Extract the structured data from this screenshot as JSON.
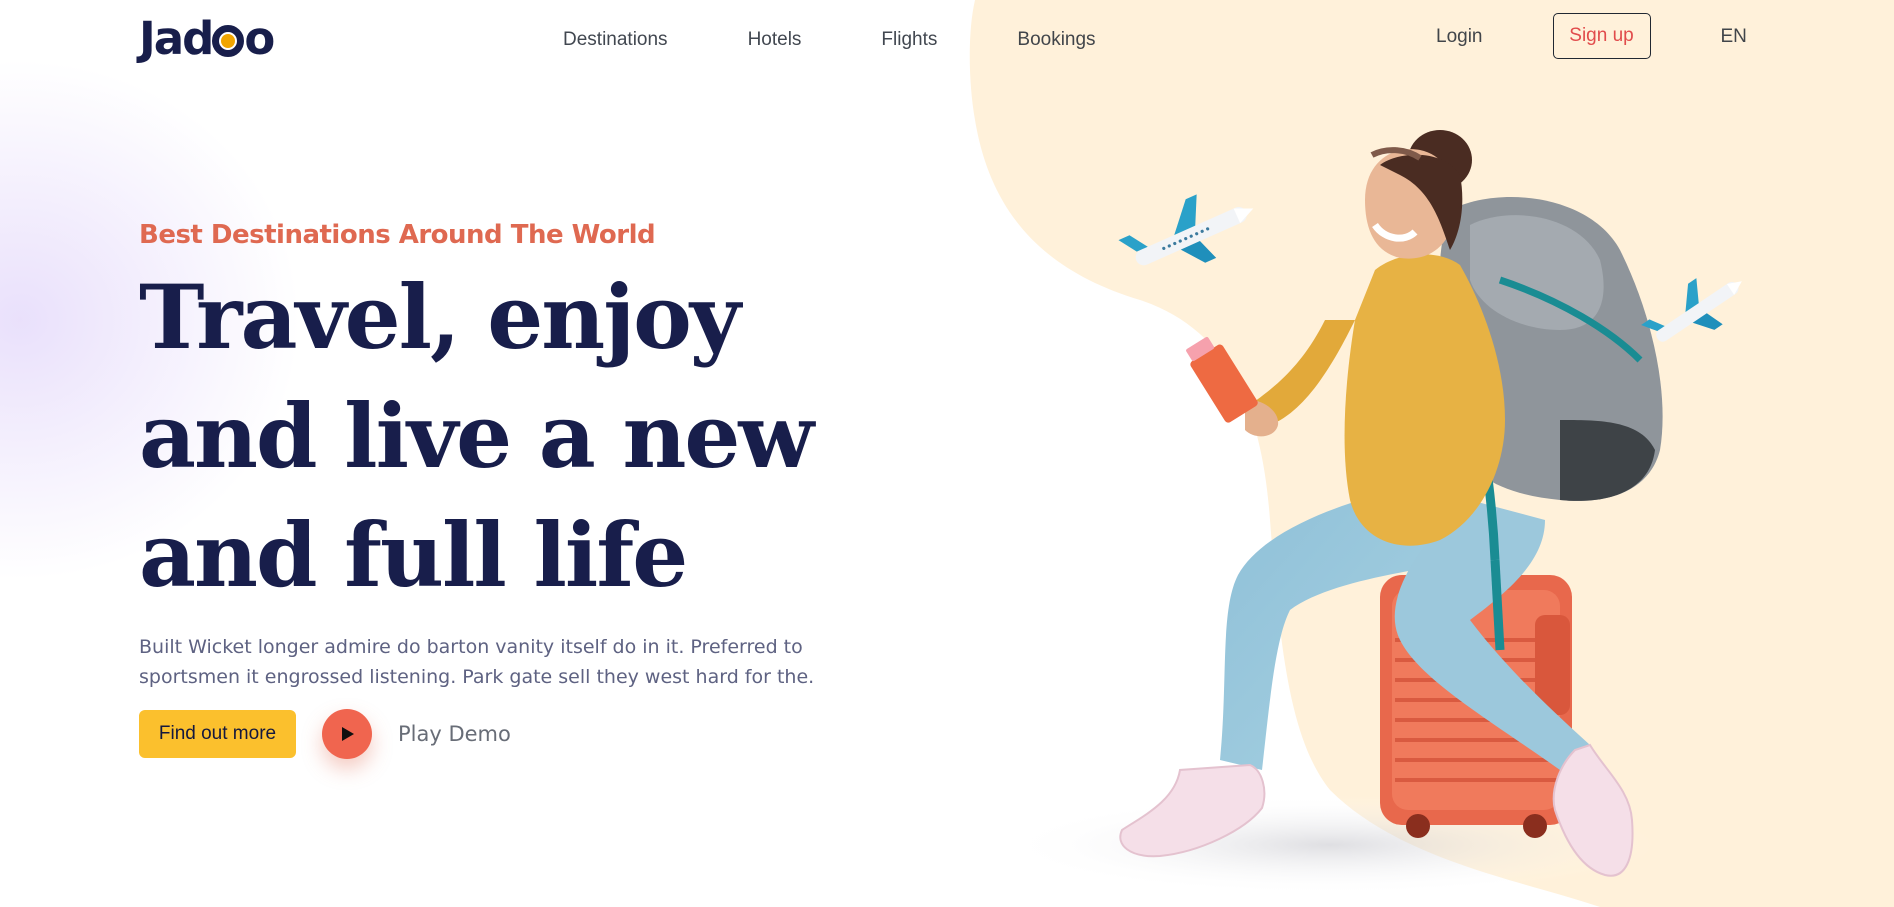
{
  "brand": {
    "logo_text_left": "Jad",
    "logo_text_right": "o",
    "accent_color": "#df6951",
    "yellow_color": "#f1a501"
  },
  "nav": {
    "links": [
      "Destinations",
      "Hotels",
      "Flights",
      "Bookings"
    ],
    "login": "Login",
    "signup": "Sign up",
    "language": "EN"
  },
  "hero": {
    "eyebrow": "Best Destinations Around The World",
    "headline_lines": [
      "Travel, enjoy",
      "and live a new",
      "and full life"
    ],
    "description": "Built Wicket longer admire do barton vanity itself do in it. Preferred to sportsmen it engrossed listening. Park gate sell they west hard for the.",
    "cta_label": "Find out more",
    "play_label": "Play Demo"
  },
  "icons": {
    "play": "play-icon",
    "plane": "airplane-icon"
  }
}
